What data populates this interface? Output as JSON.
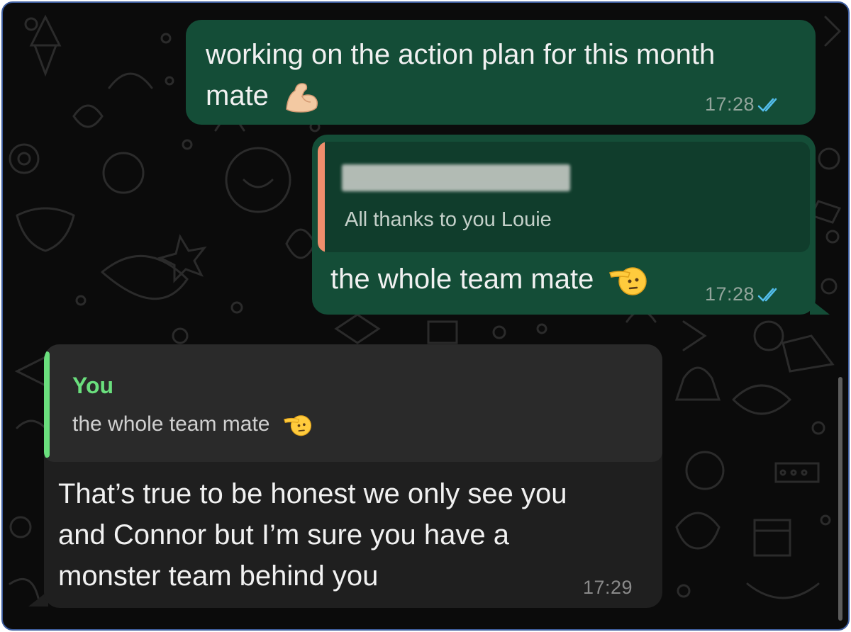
{
  "chat": {
    "messages": [
      {
        "direction": "outgoing",
        "text_line1": "working on the action plan for this month",
        "text_line2": "mate",
        "emoji": "flexed-biceps",
        "time": "17:28",
        "status": "read"
      },
      {
        "direction": "outgoing",
        "quoted_text": "All thanks to you Louie",
        "text": "the whole team mate",
        "emoji": "saluting-face",
        "time": "17:28",
        "status": "read"
      },
      {
        "direction": "incoming",
        "quoted_author": "You",
        "quoted_text": "the whole team mate",
        "text_line1": "That’s true to be honest we only see you",
        "text_line2": "and Connor but I’m sure you have a",
        "text_line3": "monster team behind you",
        "time": "17:29"
      }
    ]
  },
  "colors": {
    "outgoing_bubble": "#144d37",
    "incoming_bubble": "#1f1f1f",
    "quote_bar_outgoing": "#f08e6c",
    "quote_bar_incoming": "#6adf7d",
    "read_ticks": "#53bdeb",
    "background": "#0b0b0b"
  }
}
